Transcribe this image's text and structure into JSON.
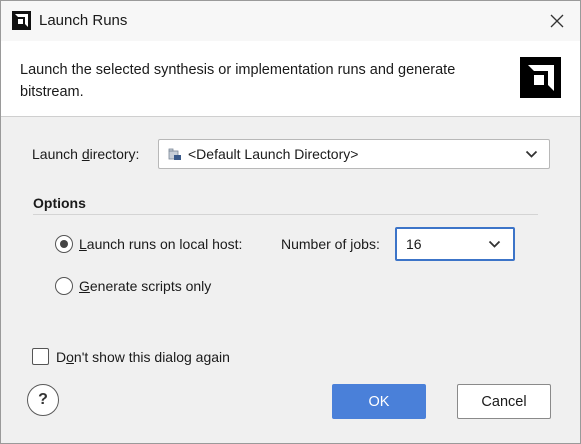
{
  "window": {
    "title": "Launch Runs",
    "close_glyph": "✕"
  },
  "header": {
    "description": "Launch the selected synthesis or implementation runs and generate bitstream."
  },
  "launch_directory": {
    "label_before": "Launch ",
    "label_mnemonic": "d",
    "label_after": "irectory:",
    "value": "<Default Launch Directory>",
    "icon": "folder-icon"
  },
  "options": {
    "title": "Options",
    "local_host": {
      "mnemonic": "L",
      "label_rest": "aunch runs on local host:",
      "selected": true
    },
    "jobs": {
      "label_before": "Number of ",
      "label_mnemonic": "j",
      "label_after": "obs:",
      "value": "16"
    },
    "scripts_only": {
      "mnemonic": "G",
      "label_rest": "enerate scripts only",
      "selected": false
    }
  },
  "dont_show": {
    "label_before": "D",
    "label_mnemonic": "o",
    "label_after": "n't show this dialog again",
    "checked": false
  },
  "buttons": {
    "help": "?",
    "ok": "OK",
    "cancel": "Cancel"
  },
  "colors": {
    "accent": "#4a80d9",
    "focus_border": "#3c74c8",
    "dialog_bg": "#f0f0f0"
  }
}
